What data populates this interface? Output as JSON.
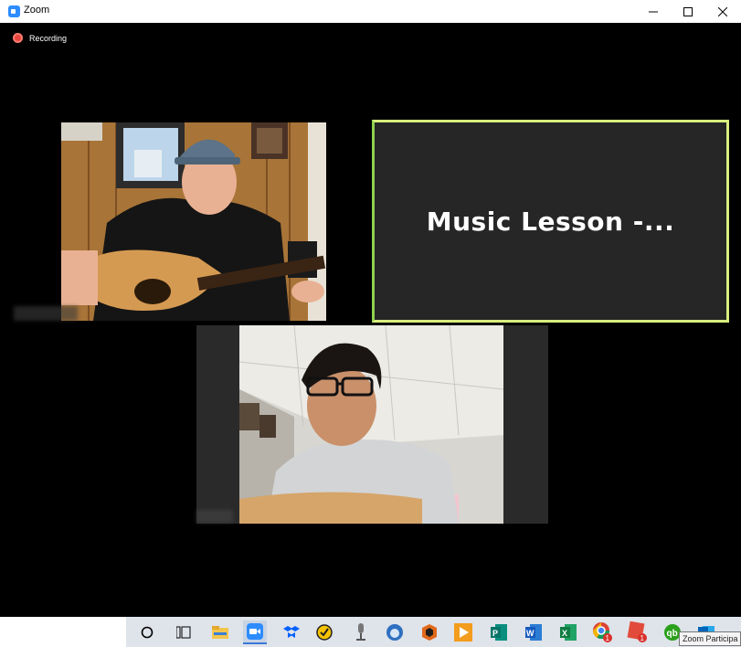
{
  "window": {
    "title": "Zoom",
    "controls": {
      "minimize": "minimize",
      "maximize": "maximize",
      "close": "close"
    }
  },
  "meeting": {
    "recording_label": "Recording",
    "shared_title": "Music Lesson -...",
    "colors": {
      "active_speaker_border": "#d8ee7e",
      "recording_dot": "#e8453c",
      "background": "#000000",
      "tile_bg": "#262626"
    }
  },
  "taskbar": {
    "icons": [
      "cortana-circle-icon",
      "task-view-icon",
      "file-explorer-icon",
      "zoom-icon",
      "dropbox-icon",
      "norton-icon",
      "microphone-app-icon",
      "thunderbird-icon",
      "orange-app-icon",
      "slides-app-icon",
      "publisher-icon",
      "word-icon",
      "excel-icon",
      "chrome-icon",
      "red-app-icon",
      "quickbooks-icon",
      "outlook-icon"
    ],
    "badges": {
      "chrome": "1",
      "red_app": "1"
    },
    "tooltip": "Zoom Participa"
  }
}
